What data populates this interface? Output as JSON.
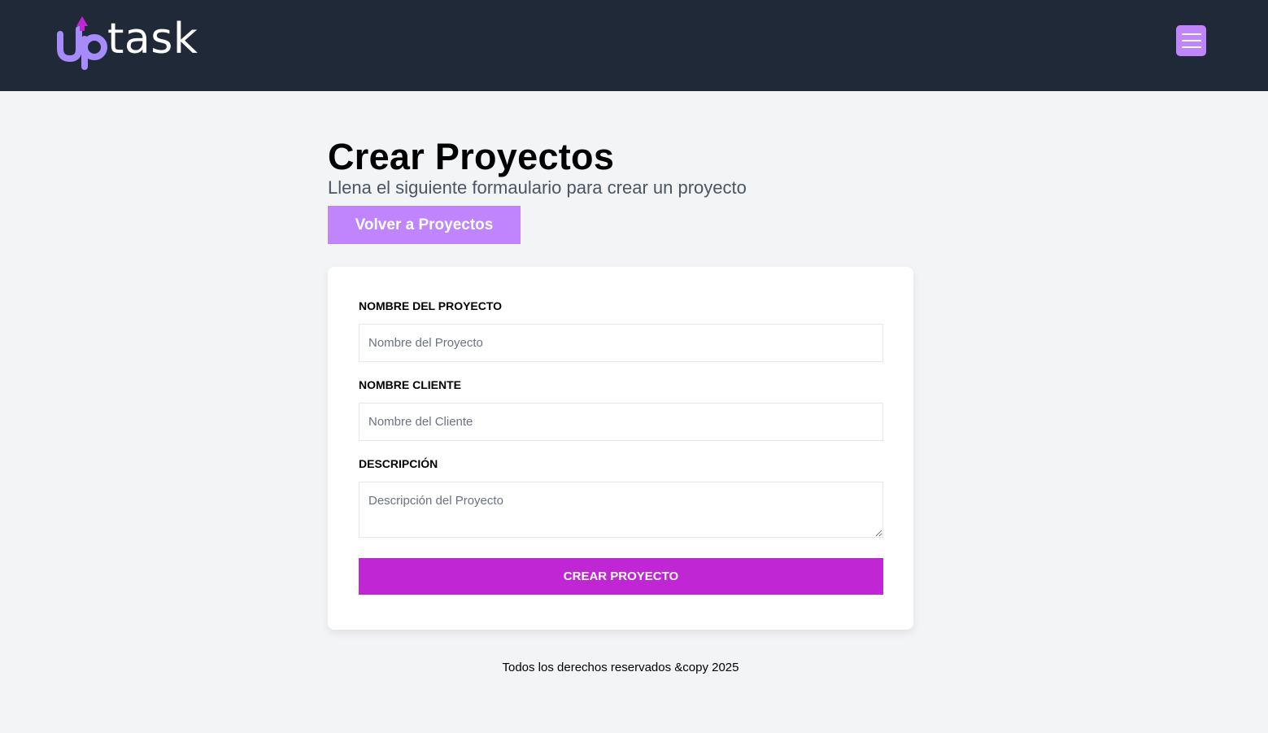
{
  "header": {
    "logo_text": "uptask",
    "menu_icon": "hamburger-menu-icon",
    "accent_color": "#c084fc",
    "logo_arrow_color": "#c026d3"
  },
  "main": {
    "title": "Crear Proyectos",
    "subtitle": "Llena el siguiente formaulario para crear un proyecto",
    "back_button_label": "Volver a Proyectos"
  },
  "form": {
    "project_name_label": "Nombre del Proyecto",
    "project_name_placeholder": "Nombre del Proyecto",
    "project_name_value": "",
    "client_name_label": "Nombre Cliente",
    "client_name_placeholder": "Nombre del Cliente",
    "client_name_value": "",
    "description_label": "Descripción",
    "description_placeholder": "Descripción del Proyecto",
    "description_value": "",
    "submit_label": "Crear Proyecto",
    "submit_color": "#c026d3"
  },
  "footer": {
    "text": "Todos los derechos reservados &copy 2025"
  }
}
